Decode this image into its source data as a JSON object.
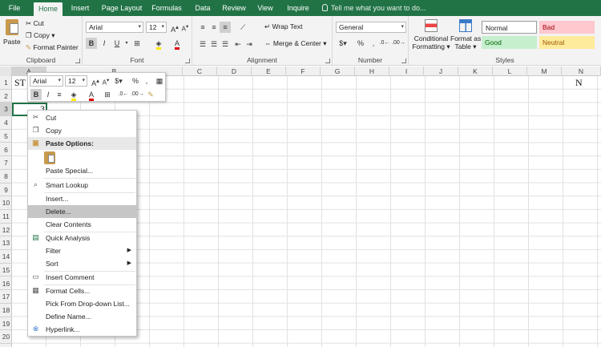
{
  "tabs": [
    "File",
    "Home",
    "Insert",
    "Page Layout",
    "Formulas",
    "Data",
    "Review",
    "View",
    "Inquire"
  ],
  "tell_me": "Tell me what you want to do...",
  "ribbon": {
    "clipboard": {
      "paste": "Paste",
      "cut": "Cut",
      "copy": "Copy",
      "format_painter": "Format Painter",
      "label": "Clipboard"
    },
    "font": {
      "name": "Arial",
      "size": "12",
      "label": "Font"
    },
    "alignment": {
      "wrap": "Wrap Text",
      "merge": "Merge & Center",
      "label": "Alignment"
    },
    "number": {
      "format": "General",
      "label": "Number"
    },
    "styles": {
      "conditional": "Conditional",
      "conditional2": "Formatting",
      "format_as": "Format as",
      "format_as2": "Table",
      "normal": "Normal",
      "bad": "Bad",
      "good": "Good",
      "neutral": "Neutral",
      "label": "Styles"
    }
  },
  "columns": [
    "A",
    "B",
    "C",
    "D",
    "E",
    "F",
    "G",
    "H",
    "I",
    "J",
    "K",
    "L",
    "M",
    "N"
  ],
  "rows": [
    "1",
    "2",
    "3",
    "4",
    "5",
    "6",
    "7",
    "8",
    "9",
    "10",
    "11",
    "12",
    "13",
    "14",
    "15",
    "16",
    "17",
    "18",
    "19",
    "20"
  ],
  "cells": {
    "a1": "ST",
    "n1": "N",
    "c3": "3"
  },
  "mini_toolbar": {
    "font": "Arial",
    "size": "12"
  },
  "context_menu": {
    "cut": "Cut",
    "copy": "Copy",
    "paste_options": "Paste Options:",
    "paste_special": "Paste Special...",
    "smart_lookup": "Smart Lookup",
    "insert": "Insert...",
    "delete": "Delete...",
    "clear_contents": "Clear Contents",
    "quick_analysis": "Quick Analysis",
    "filter": "Filter",
    "sort": "Sort",
    "insert_comment": "Insert Comment",
    "format_cells": "Format Cells...",
    "pick_list": "Pick From Drop-down List...",
    "define_name": "Define Name...",
    "hyperlink": "Hyperlink..."
  },
  "colors": {
    "accent": "#217346",
    "bad_bg": "#ffc7ce",
    "bad_fg": "#9c0006",
    "good_bg": "#c6efce",
    "good_fg": "#006100",
    "neutral_bg": "#ffeb9c",
    "neutral_fg": "#9c5700"
  }
}
